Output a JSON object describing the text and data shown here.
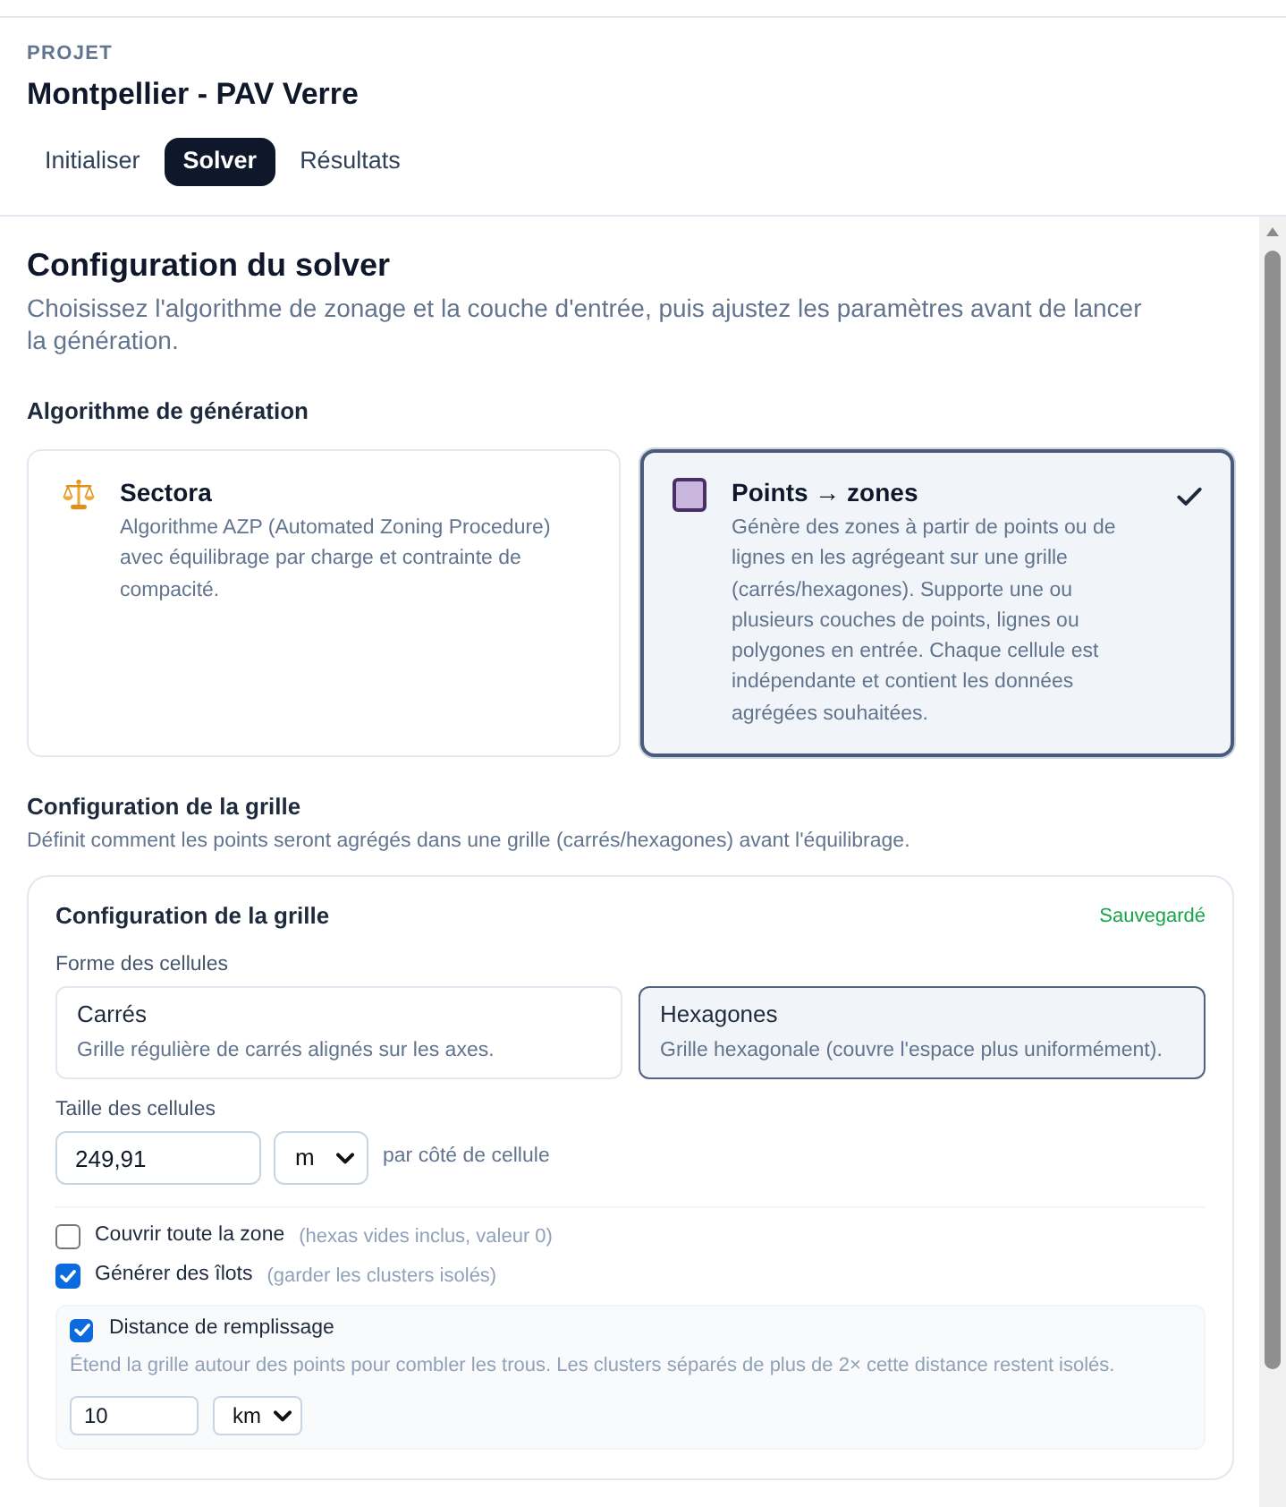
{
  "project": {
    "label": "PROJET",
    "title": "Montpellier - PAV Verre"
  },
  "tabs": [
    {
      "label": "Initialiser",
      "selected": false
    },
    {
      "label": "Solver",
      "selected": true
    },
    {
      "label": "Résultats",
      "selected": false
    }
  ],
  "solver": {
    "title": "Configuration du solver",
    "description": "Choisissez l'algorithme de zonage et la couche d'entrée, puis ajustez les paramètres avant de lancer la génération.",
    "algorithm_heading": "Algorithme de génération",
    "algorithms": [
      {
        "kind": "scale",
        "title": "Sectora",
        "description": "Algorithme AZP (Automated Zoning Procedure) avec équilibrage par charge et contrainte de compacité.",
        "selected": false
      },
      {
        "kind": "square",
        "title": "Points → zones",
        "description": "Génère des zones à partir de points ou de lignes en les agrégeant sur une grille (carrés/hexagones). Supporte une ou plusieurs couches de points, lignes ou polygones en entrée. Chaque cellule est indépendante et contient les données agrégées souhaitées.",
        "selected": true
      }
    ]
  },
  "grid_section": {
    "title": "Configuration de la grille",
    "description": "Définit comment les points seront agrégés dans une grille (carrés/hexagones) avant l'équilibrage.",
    "card": {
      "title": "Configuration de la grille",
      "status": "Sauvegardé",
      "shape_label": "Forme des cellules",
      "shapes": [
        {
          "title": "Carrés",
          "description": "Grille régulière de carrés alignés sur les axes.",
          "selected": false
        },
        {
          "title": "Hexagones",
          "description": "Grille hexagonale (couvre l'espace plus uniformément).",
          "selected": true
        }
      ],
      "size_label": "Taille des cellules",
      "size_value": "249,91",
      "size_unit": "m",
      "size_suffix": "par côté de cellule",
      "options": [
        {
          "label": "Couvrir toute la zone",
          "hint": "(hexas vides inclus, valeur 0)",
          "checked": false
        },
        {
          "label": "Générer des îlots",
          "hint": "(garder les clusters isolés)",
          "checked": true
        }
      ],
      "fill_distance": {
        "label": "Distance de remplissage",
        "checked": true,
        "description": "Étend la grille autour des points pour combler les trous. Les clusters séparés de plus de 2× cette distance restent isolés.",
        "value": "10",
        "unit": "km"
      }
    }
  }
}
